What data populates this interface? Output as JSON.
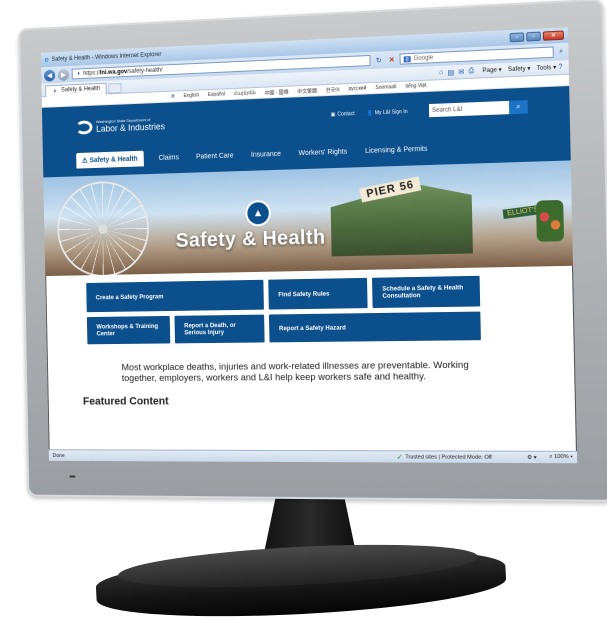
{
  "browser": {
    "window_title": "Safety & Health - Windows Internet Explorer",
    "url_prefix": "https://",
    "url_host": "lni.wa.gov",
    "url_path": "/safety-health/",
    "search_placeholder": "Google",
    "tab_label": "Safety & Health",
    "toolbar": {
      "page": "Page ▾",
      "safety": "Safety ▾",
      "tools": "Tools ▾"
    },
    "status": {
      "left": "Done",
      "trusted": "Trusted sites | Protected Mode: Off",
      "zoom": "100%"
    }
  },
  "site": {
    "languages": [
      "English",
      "Español",
      "Հայերեն",
      "中國 - 國博",
      "中文繁體",
      "한국어",
      "русский",
      "Soomaali",
      "tiếng Việt"
    ],
    "logo_small": "Washington State Department of",
    "logo_big": "Labor & Industries",
    "contact": "Contact",
    "signin": "My L&I Sign In",
    "search_placeholder": "Search L&I",
    "nav": [
      "Safety & Health",
      "Claims",
      "Patient Care",
      "Insurance",
      "Workers' Rights",
      "Licensing & Permits"
    ],
    "hero": {
      "title": "Safety & Health",
      "sign1": "PIER 56",
      "sign2": "ELLIOT'S"
    },
    "tiles": {
      "create_program": "Create a Safety Program",
      "find_rules": "Find Safety Rules",
      "schedule": "Schedule a Safety & Health Consultation",
      "workshops": "Workshops & Training Center",
      "report_death": "Report a Death, or Serious Injury",
      "report_hazard": "Report a Safety Hazard"
    },
    "intro": "Most workplace deaths, injuries and work-related illnesses are preventable. Working together, employers, workers and L&I help keep workers safe and healthy.",
    "featured_heading": "Featured Content"
  }
}
